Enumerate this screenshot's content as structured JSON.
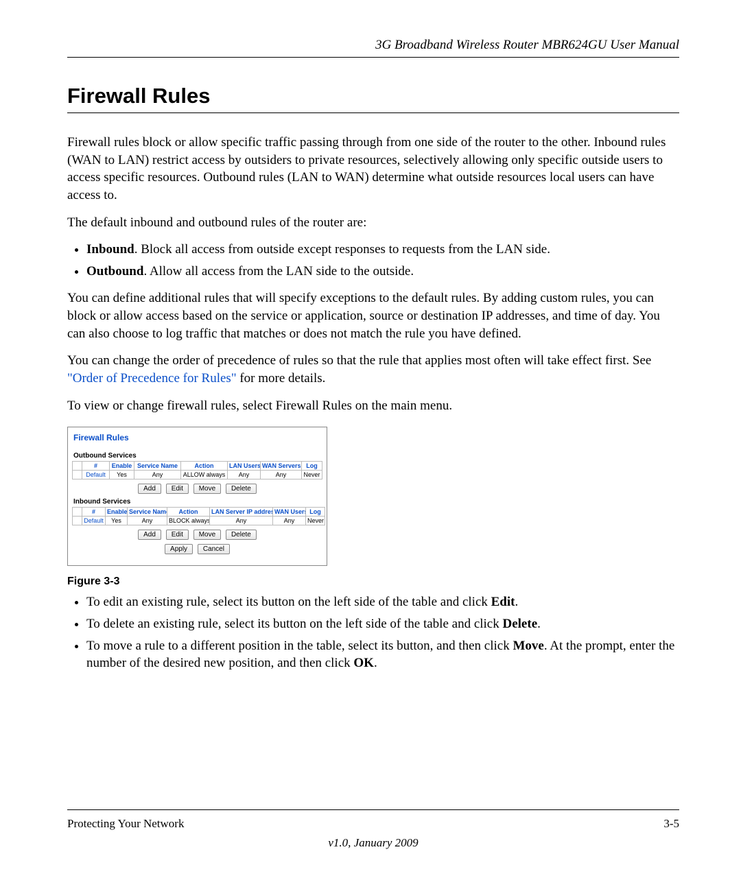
{
  "header": {
    "title": "3G Broadband Wireless Router MBR624GU User Manual"
  },
  "section": {
    "heading": "Firewall Rules",
    "para1": "Firewall rules block or allow specific traffic passing through from one side of the router to the other. Inbound rules (WAN to LAN) restrict access by outsiders to private resources, selectively allowing only specific outside users to access specific resources. Outbound rules (LAN to WAN) determine what outside resources local users can have access to.",
    "para2a": "The default inbound and outbound rules of the ",
    "para2b": "router",
    "para2c": " are:",
    "bullets_defaults": {
      "inbound_label": "Inbound",
      "inbound_text": ". Block all access from outside except responses to requests from the LAN side.",
      "outbound_label": "Outbound",
      "outbound_text": ". Allow all access from the LAN side to the outside."
    },
    "para3": "You can define additional rules that will specify exceptions to the default rules. By adding custom rules, you can block or allow access based on the service or application, source or destination IP addresses, and time of day. You can also choose to log traffic that matches or does not match the rule you have defined.",
    "para4a": "You can change the order of precedence of rules so that the rule that applies most often will take effect first. See ",
    "para4_link": "\"Order of Precedence for Rules\"",
    "para4b": " for more details.",
    "para5": "To view or change firewall rules, select Firewall Rules on the main menu."
  },
  "screenshot": {
    "title": "Firewall Rules",
    "outbound_label": "Outbound Services",
    "outbound_headers": [
      "",
      "#",
      "Enable",
      "Service Name",
      "Action",
      "LAN Users",
      "WAN Servers",
      "Log"
    ],
    "outbound_row": [
      "",
      "Default",
      "Yes",
      "Any",
      "ALLOW always",
      "Any",
      "Any",
      "Never"
    ],
    "inbound_label": "Inbound Services",
    "inbound_headers": [
      "",
      "#",
      "Enable",
      "Service Name",
      "Action",
      "LAN Server IP address",
      "WAN Users",
      "Log"
    ],
    "inbound_row": [
      "",
      "Default",
      "Yes",
      "Any",
      "BLOCK always",
      "Any",
      "Any",
      "Never"
    ],
    "buttons_row": {
      "add": "Add",
      "edit": "Edit",
      "move": "Move",
      "delete": "Delete"
    },
    "bottom_buttons": {
      "apply": "Apply",
      "cancel": "Cancel"
    }
  },
  "figure_caption": "Figure 3-3",
  "post_figure_bullets": {
    "b1a": "To edit an existing rule, select its button on the left side of the table and click ",
    "b1b": "Edit",
    "b1c": ".",
    "b2a": "To delete an existing rule, select its button on the left side of the table and click ",
    "b2b": "Delete",
    "b2c": ".",
    "b3a": "To move a rule to a different position in the table, select its button, and then click ",
    "b3b": "Move",
    "b3c": ". At the prompt, enter the number of the desired new position, and then click ",
    "b3d": "OK",
    "b3e": "."
  },
  "footer": {
    "left": "Protecting Your Network",
    "right": "3-5",
    "version": "v1.0, January 2009"
  }
}
